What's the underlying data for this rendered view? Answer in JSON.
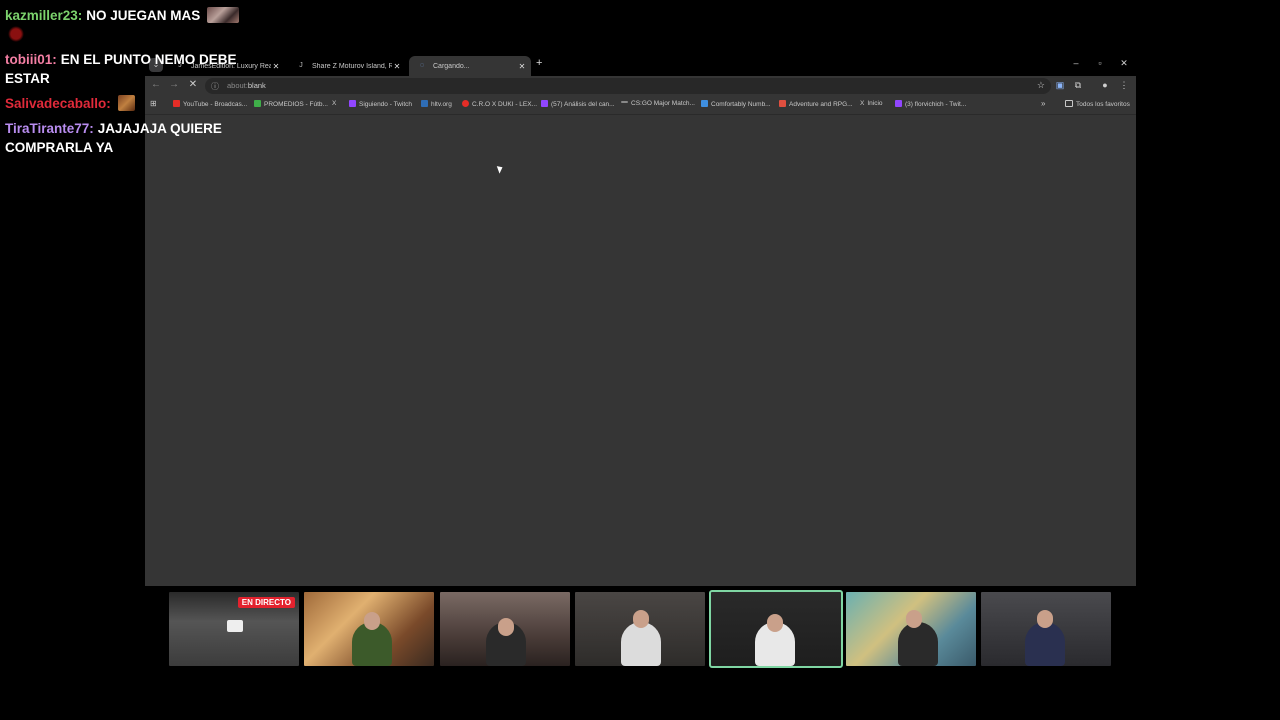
{
  "chat": {
    "messages": [
      {
        "user": "kazmiller23:",
        "user_color": "#7cd26d",
        "text": "NO JUEGAN MAS",
        "emotes": [
          "meme-emote",
          "red-emote"
        ]
      },
      {
        "user": "tobiii01:",
        "user_color": "#f47fa4",
        "text": "EN EL PUNTO NEMO DEBE ESTAR",
        "emotes": []
      },
      {
        "user": "Salivadecaballo:",
        "user_color": "#e02a3a",
        "text": "",
        "emotes": [
          "meme-emote"
        ]
      },
      {
        "user": "TiraTirante77:",
        "user_color": "#b98df0",
        "text": "JAJAJAJA QUIERE COMPRARLA YA",
        "emotes": []
      }
    ]
  },
  "browser": {
    "tabs": [
      {
        "title": "JamesEdition: Luxury Real Estat",
        "favicon": "J",
        "active": false
      },
      {
        "title": "Share Z Moturov Island, Russell",
        "favicon": "J",
        "active": false
      },
      {
        "title": "Cargando...",
        "favicon": "spinner-icon",
        "active": true
      }
    ],
    "new_tab_label": "+",
    "window_controls": [
      "minimize",
      "maximize",
      "close"
    ],
    "address": {
      "url": "about:blank",
      "url_dim": "about:",
      "url_strong": "blank"
    },
    "bookmarks": [
      {
        "label": "YouTube - Broadcas...",
        "color": "#e52d27"
      },
      {
        "label": "PROMEDIOS - Fútb...",
        "color": "#3fae49"
      },
      {
        "label": "",
        "icon": "X",
        "color": "#ffffff"
      },
      {
        "label": "Siguiendo - Twitch",
        "color": "#9146ff"
      },
      {
        "label": "hltv.org",
        "color": "#2f6db5"
      },
      {
        "label": "C.R.O X DUKI - LEX...",
        "color": "#e52d27"
      },
      {
        "label": "(57) Análisis del can...",
        "color": "#9146ff"
      },
      {
        "label": "CS:GO Major Match...",
        "color": "#888888"
      },
      {
        "label": "Comfortably Numb...",
        "color": "#3f8fe0"
      },
      {
        "label": "Adventure and RPG...",
        "color": "#e04f3f"
      },
      {
        "label": "Inicio",
        "icon": "X",
        "color": "#ffffff"
      },
      {
        "label": "(3) florvichich - Twit...",
        "color": "#9146ff"
      }
    ],
    "all_bookmarks_label": "Todos los favoritos"
  },
  "streams": {
    "live_badge": "EN DIRECTO",
    "thumbnails": [
      {
        "id": "stream-1",
        "bg": "#3a3a3a",
        "live": true
      },
      {
        "id": "stream-2",
        "bg": "#8a5a3a"
      },
      {
        "id": "stream-3",
        "bg": "#5a4a44"
      },
      {
        "id": "stream-4",
        "bg": "#3a3836"
      },
      {
        "id": "stream-5",
        "bg": "#2e2e2e",
        "active": true
      },
      {
        "id": "stream-6",
        "bg": "#4a7a7a"
      },
      {
        "id": "stream-7",
        "bg": "#3a3a3e"
      }
    ]
  }
}
